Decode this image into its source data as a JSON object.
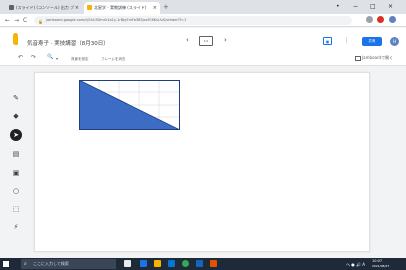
{
  "browser": {
    "tabs": [
      {
        "label": "(スライド) (コンソール) 出力 ブ",
        "close": "×"
      },
      {
        "label": "北星学 - 実教訓練 (スライド)",
        "close": "×"
      }
    ],
    "new_tab": "+",
    "window_controls": [
      "•",
      "−",
      "□",
      "×"
    ],
    "back": "←",
    "forward": "→",
    "reload": "C",
    "url": "jamboard.google.com/d/1kU5Xm4r1a1y-1rBjq7mFa3B5jxxfC6KvUuS/viewer?f=1",
    "lock": "🔒"
  },
  "app": {
    "title": "気音寿子 · 実技講習（8月30日）",
    "prev": "‹",
    "next": "›",
    "frame_label": "1/1",
    "share_label": "共有",
    "avatar_letter": "H"
  },
  "toolbar": {
    "undo": "↶",
    "redo": "↷",
    "zoom": "🔍",
    "zoom_caret": "▾",
    "set_background": "背景を設定",
    "clear_frame": "フレームを消去",
    "open_jamboard": "Jamboardで開く"
  },
  "left_tools": [
    "✎",
    "◆",
    "➤",
    "▤",
    "▣",
    "○",
    "⬚",
    "⚡"
  ],
  "taskbar": {
    "search_placeholder": "ここに入力して検索",
    "time": "10:07",
    "date": "2021/08/27",
    "tray": "へ ● 🔊 A"
  },
  "colors": {
    "triangle": "#3d6cc4",
    "accent": "#1a73e8",
    "logo": "#f4b400"
  }
}
